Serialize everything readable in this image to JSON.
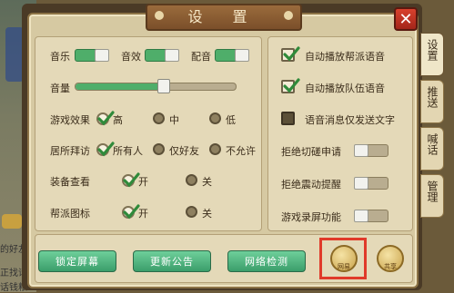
{
  "title": "设 置",
  "close_label": "✕",
  "background_chat": {
    "line1": "的好友",
    "line2": "正找话",
    "line3": "话钱粮"
  },
  "audio": {
    "music_label": "音乐",
    "music_on": true,
    "sfx_label": "音效",
    "sfx_on": true,
    "voice_label": "配音",
    "voice_on": true,
    "volume_label": "音量",
    "volume_level": 0.55
  },
  "game_effect": {
    "label": "游戏效果",
    "options": [
      "高",
      "中",
      "低"
    ],
    "selected": "高"
  },
  "residence_visit": {
    "label": "居所拜访",
    "options": [
      "所有人",
      "仅好友",
      "不允许"
    ],
    "selected": "所有人"
  },
  "equipment_view": {
    "label": "装备查看",
    "options": [
      "开",
      "关"
    ],
    "selected": "开"
  },
  "guild_icon": {
    "label": "帮派图标",
    "options": [
      "开",
      "关"
    ],
    "selected": "开"
  },
  "right_settings": {
    "auto_guild_voice": {
      "label": "自动播放帮派语音",
      "checked": true
    },
    "auto_team_voice": {
      "label": "自动播放队伍语音",
      "checked": true
    },
    "voice_text_only": {
      "label": "语音消息仅发送文字",
      "checked": false
    },
    "refuse_spar": {
      "label": "拒绝切磋申请",
      "on": false
    },
    "refuse_vibrate": {
      "label": "拒绝震动提醒",
      "on": false
    },
    "screen_record": {
      "label": "游戏录屏功能",
      "on": false
    }
  },
  "side_tabs": [
    {
      "label": "设置",
      "active": true
    },
    {
      "label": "推送",
      "active": false
    },
    {
      "label": "喊话",
      "active": false
    },
    {
      "label": "管理",
      "active": false
    }
  ],
  "footer_buttons": {
    "lock_screen": "锁定屏幕",
    "update_notice": "更新公告",
    "network_check": "网络检测"
  },
  "footer_icons": {
    "left_caption": "网易",
    "right_caption": "共享"
  },
  "colors": {
    "accent_green": "#4fae6a",
    "highlight_red": "#e03a2a",
    "panel_bg": "#d6c9a2",
    "title_brown": "#7b4f2a"
  }
}
